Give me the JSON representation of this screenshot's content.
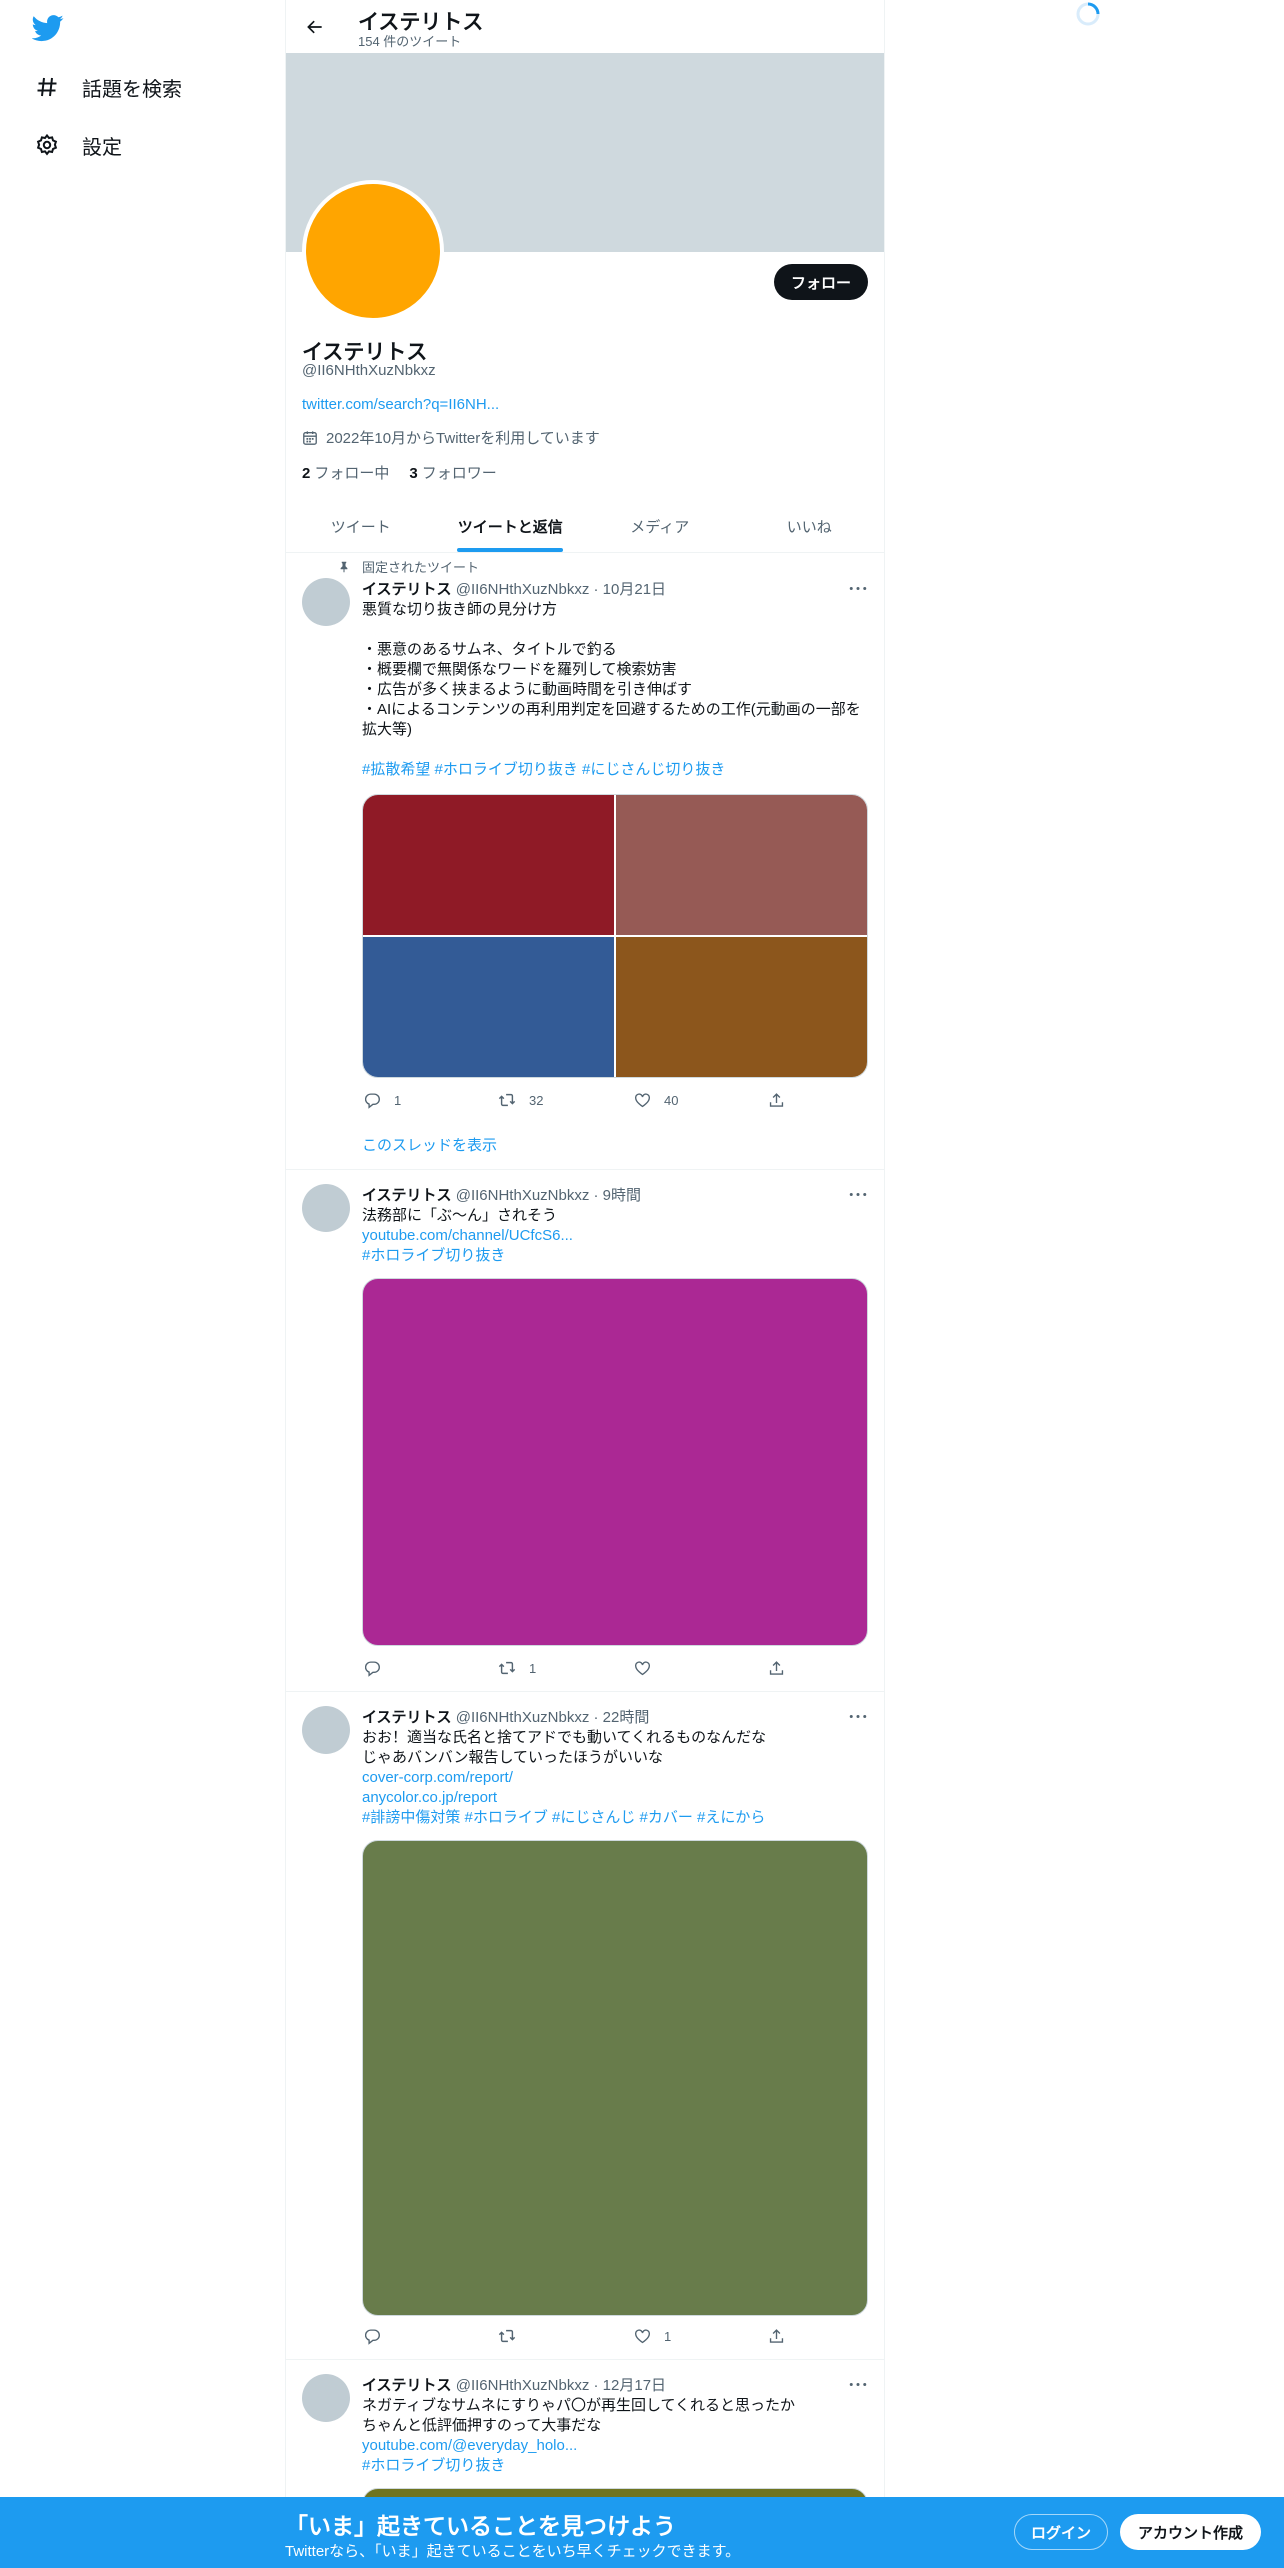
{
  "nav": {
    "items": [
      {
        "label": "話題を検索",
        "icon": "hashtag-icon"
      },
      {
        "label": "設定",
        "icon": "gear-icon"
      }
    ]
  },
  "header": {
    "title": "イステリトス",
    "subtitle": "154 件のツイート"
  },
  "profile": {
    "follow_label": "フォロー",
    "name": "イステリトス",
    "handle": "@II6NHthXuzNbkxz",
    "link": "twitter.com/search?q=II6NH...",
    "joined": "2022年10月からTwitterを利用しています",
    "following_count": "2",
    "following_label": "フォロー中",
    "followers_count": "3",
    "followers_label": "フォロワー",
    "avatar_color": "#ffa500",
    "banner_color": "#cfd9de"
  },
  "tabs": [
    {
      "label": "ツイート",
      "active": false
    },
    {
      "label": "ツイートと返信",
      "active": true
    },
    {
      "label": "メディア",
      "active": false
    },
    {
      "label": "いいね",
      "active": false
    }
  ],
  "tweets": [
    {
      "pinned_label": "固定されたツイート",
      "name": "イステリトス",
      "meta": "@II6NHthXuzNbkxz · 10月21日",
      "lines": [
        "悪質な切り抜き師の見分け方",
        "",
        "・悪意のあるサムネ、タイトルで釣る",
        "・概要欄で無関係なワードを羅列して検索妨害",
        "・広告が多く挟まるように動画時間を引き伸ばす",
        "・AIによるコンテンツの再利用判定を回避するための工作(元動画の一部を",
        "拡大等)",
        ""
      ],
      "links": [
        "#拡散希望 #ホロライブ切り抜き #にじさんじ切り抜き"
      ],
      "media_colors": [
        "#8f1a26",
        "#965a55",
        "#335b96",
        "#8c561c"
      ],
      "reply_count": "1",
      "retweet_count": "32",
      "like_count": "40",
      "thread_label": "このスレッドを表示"
    },
    {
      "name": "イステリトス",
      "meta": "@II6NHthXuzNbkxz · 9時間",
      "lines": [
        "法務部に「ぶ～ん」されそう"
      ],
      "links": [
        "youtube.com/channel/UCfcS6...",
        "#ホロライブ切り抜き"
      ],
      "media_colors": [
        "#ab2894"
      ],
      "reply_count": "",
      "retweet_count": "1",
      "like_count": ""
    },
    {
      "name": "イステリトス",
      "meta": "@II6NHthXuzNbkxz · 22時間",
      "lines": [
        "おお！適当な氏名と捨てアドでも動いてくれるものなんだな",
        "じゃあバンバン報告していったほうがいいな"
      ],
      "links": [
        "cover-corp.com/report/",
        "anycolor.co.jp/report",
        "#誹謗中傷対策 #ホロライブ #にじさんじ #カバー #えにから"
      ],
      "media_colors": [
        "#687c4b"
      ],
      "reply_count": "",
      "retweet_count": "",
      "like_count": "1"
    },
    {
      "name": "イステリトス",
      "meta": "@II6NHthXuzNbkxz · 12月17日",
      "lines": [
        "ネガティブなサムネにすりゃパ〇が再生回してくれると思ったか",
        "ちゃんと低評価押すのって大事だな"
      ],
      "links": [
        "youtube.com/@everyday_holo...",
        "#ホロライブ切り抜き"
      ],
      "media_colors": [
        "#6f7420"
      ]
    }
  ],
  "bottom_bar": {
    "title": "「いま」起きていることを見つけよう",
    "subtitle": "Twitterなら、「いま」起きていることをいち早くチェックできます。",
    "login_label": "ログイン",
    "signup_label": "アカウント作成"
  },
  "colors": {
    "accent": "#1d9bf0",
    "bottom_bar": "#1d9bf0"
  }
}
